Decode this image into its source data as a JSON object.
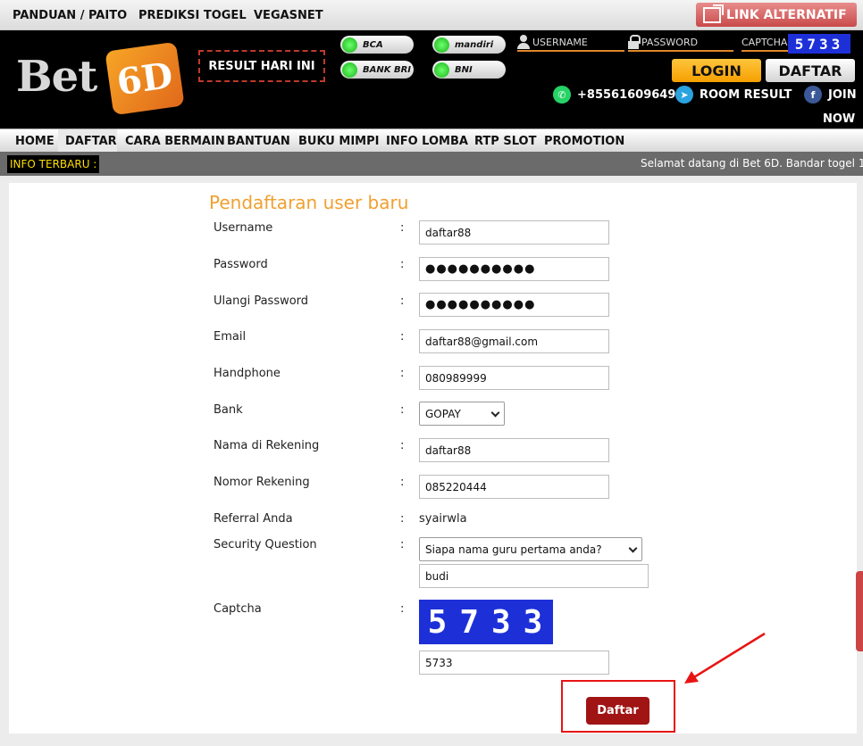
{
  "topbar": {
    "links": [
      "PANDUAN / PAITO",
      "PREDIKSI TOGEL",
      "VEGASNET"
    ],
    "link_alternatif": "LINK ALTERNATIF"
  },
  "header": {
    "logo_text": "Bet",
    "logo_mark": "6D",
    "result_button": "RESULT HARI INI",
    "banks": [
      "BCA",
      "mandiri",
      "BANK BRI",
      "BNI"
    ],
    "username_placeholder": "USERNAME",
    "password_placeholder": "PASSWORD",
    "captcha_label": "CAPTCHA",
    "captcha_code": "5733",
    "login": "LOGIN",
    "daftar": "DAFTAR",
    "whatsapp": "+85561609649",
    "room_result": "ROOM RESULT",
    "join": "JOIN",
    "now": "NOW"
  },
  "nav": {
    "items": [
      "HOME",
      "DAFTAR",
      "CARA BERMAIN",
      "BANTUAN",
      "BUKU MIMPI",
      "INFO LOMBA",
      "RTP SLOT",
      "PROMOTION"
    ]
  },
  "ticker": {
    "label": "INFO TERBARU :",
    "message": "Selamat datang di Bet 6D. Bandar togel 1"
  },
  "form": {
    "title": "Pendaftaran user baru",
    "username_label": "Username",
    "username_value": "daftar88",
    "password_label": "Password",
    "password_value": "●●●●●●●●●●",
    "password2_label": "Ulangi Password",
    "password2_value": "●●●●●●●●●●",
    "email_label": "Email",
    "email_value": "daftar88@gmail.com",
    "phone_label": "Handphone",
    "phone_value": "080989999",
    "bank_label": "Bank",
    "bank_value": "GOPAY",
    "rek_name_label": "Nama di Rekening",
    "rek_name_value": "daftar88",
    "rek_no_label": "Nomor Rekening",
    "rek_no_value": "085220444",
    "referral_label": "Referral Anda",
    "referral_value": "syairwla",
    "security_label": "Security Question",
    "security_question": "Siapa nama guru pertama anda?",
    "security_answer": "budi",
    "captcha_label": "Captcha",
    "captcha_image": "5733",
    "captcha_value": "5733",
    "colon": ":",
    "submit": "Daftar"
  },
  "colors": {
    "accent_orange": "#f0a030",
    "submit_red": "#a01414",
    "captcha_blue": "#1d30d8",
    "highlight_red": "#e81414"
  }
}
